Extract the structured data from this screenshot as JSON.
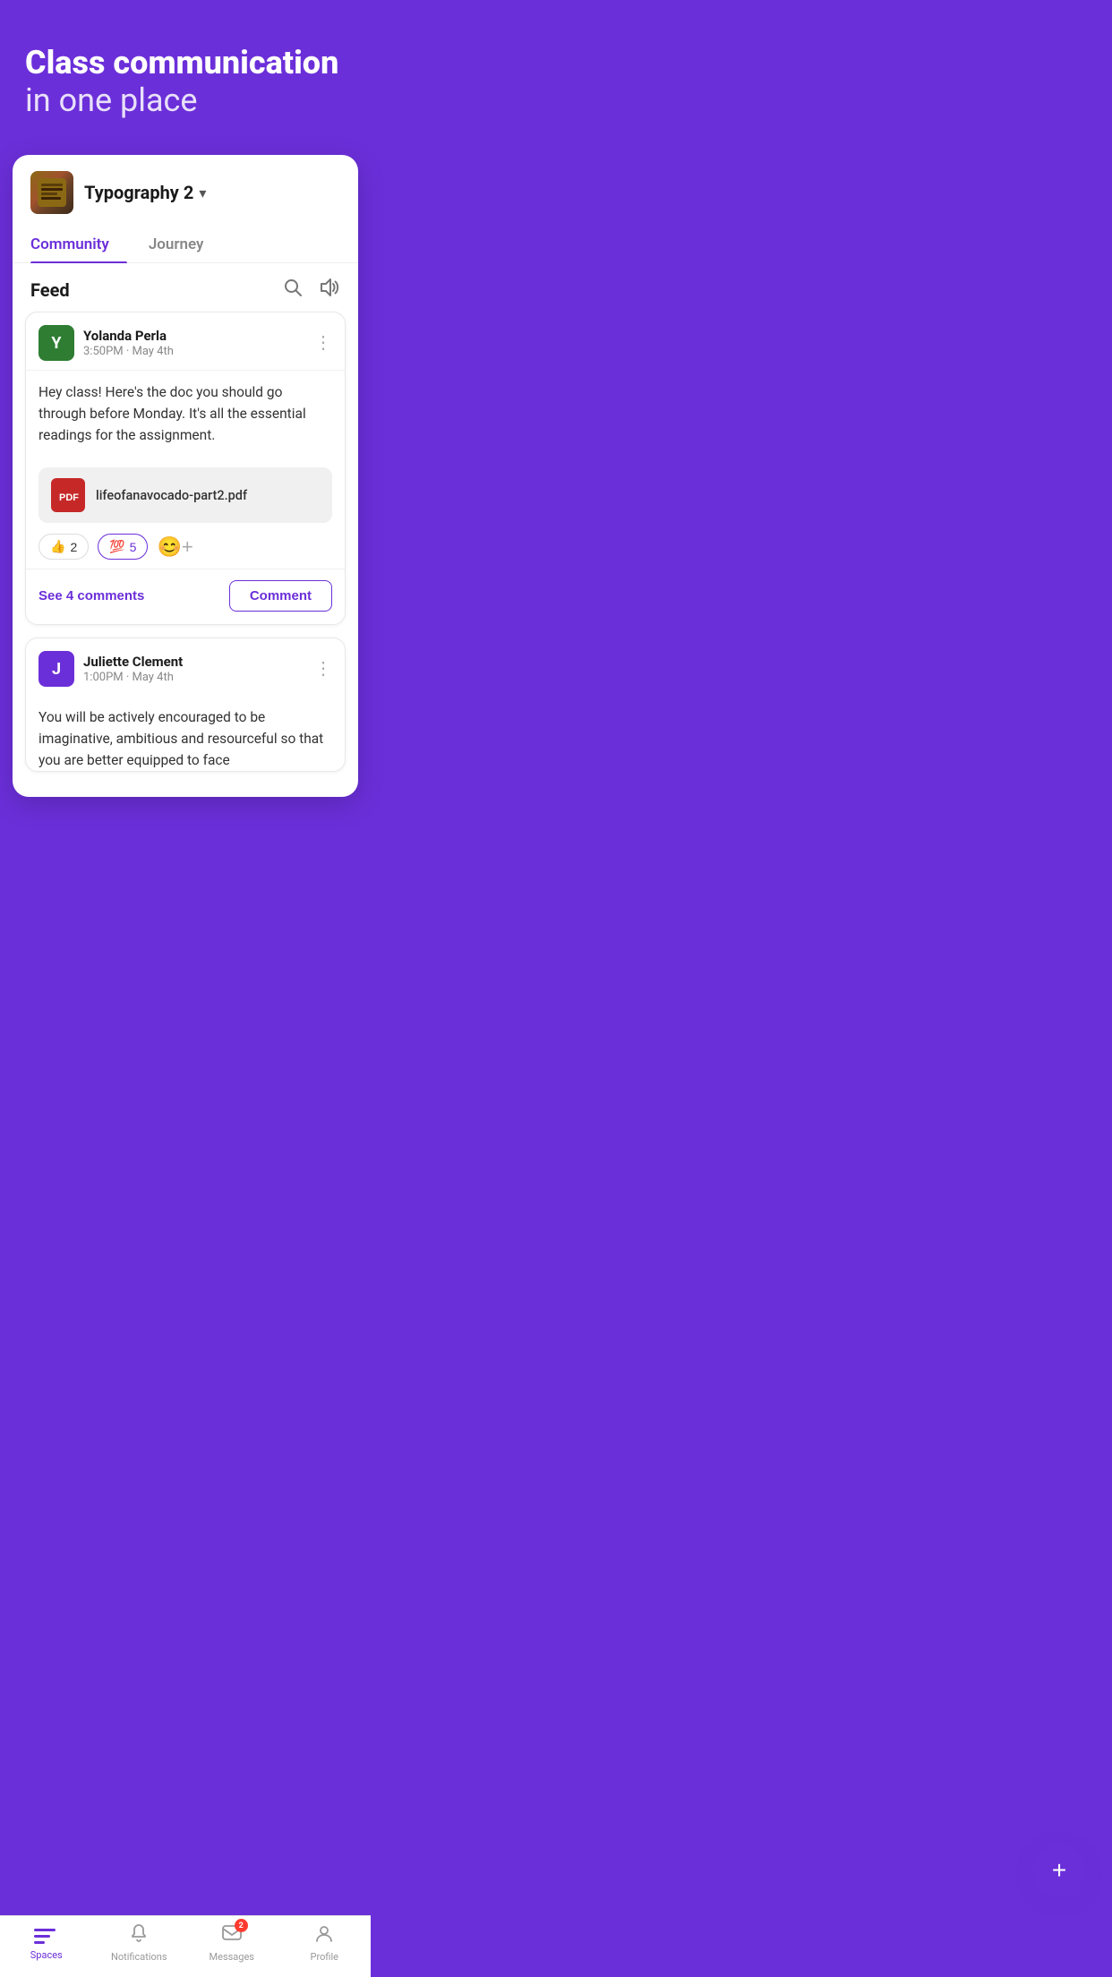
{
  "hero": {
    "title": "Class communication",
    "subtitle": "in one place"
  },
  "class": {
    "name": "Typography 2",
    "thumbnail_emoji": "📚",
    "tabs": [
      {
        "label": "Community",
        "active": true
      },
      {
        "label": "Journey",
        "active": false
      }
    ]
  },
  "feed": {
    "title": "Feed",
    "posts": [
      {
        "id": 1,
        "author": "Yolanda Perla",
        "avatar_letter": "Y",
        "avatar_color": "green",
        "time": "3:50PM · May 4th",
        "body": "Hey class! Here's the doc you should go through before Monday. It's all the essential readings for the assignment.",
        "attachment": {
          "type": "pdf",
          "name": "lifeofanavocado-part2.pdf"
        },
        "reactions": [
          {
            "emoji": "👍",
            "count": 2
          },
          {
            "emoji": "💯",
            "count": 5
          }
        ],
        "comments_count": 4,
        "comments_label": "See 4 comments",
        "comment_btn": "Comment"
      },
      {
        "id": 2,
        "author": "Juliette Clement",
        "avatar_letter": "J",
        "avatar_color": "purple",
        "time": "1:00PM · May 4th",
        "body": "You will be actively encouraged to be imaginative, ambitious and resourceful so that you are better equipped to face",
        "attachment": null,
        "reactions": [],
        "comments_count": 0,
        "comments_label": "",
        "comment_btn": ""
      }
    ]
  },
  "fab": {
    "label": "+"
  },
  "bottom_nav": {
    "items": [
      {
        "id": "spaces",
        "label": "Spaces",
        "active": true,
        "badge": null
      },
      {
        "id": "notifications",
        "label": "Notifications",
        "active": false,
        "badge": null
      },
      {
        "id": "messages",
        "label": "Messages",
        "active": false,
        "badge": 2
      },
      {
        "id": "profile",
        "label": "Profile",
        "active": false,
        "badge": null
      }
    ]
  }
}
